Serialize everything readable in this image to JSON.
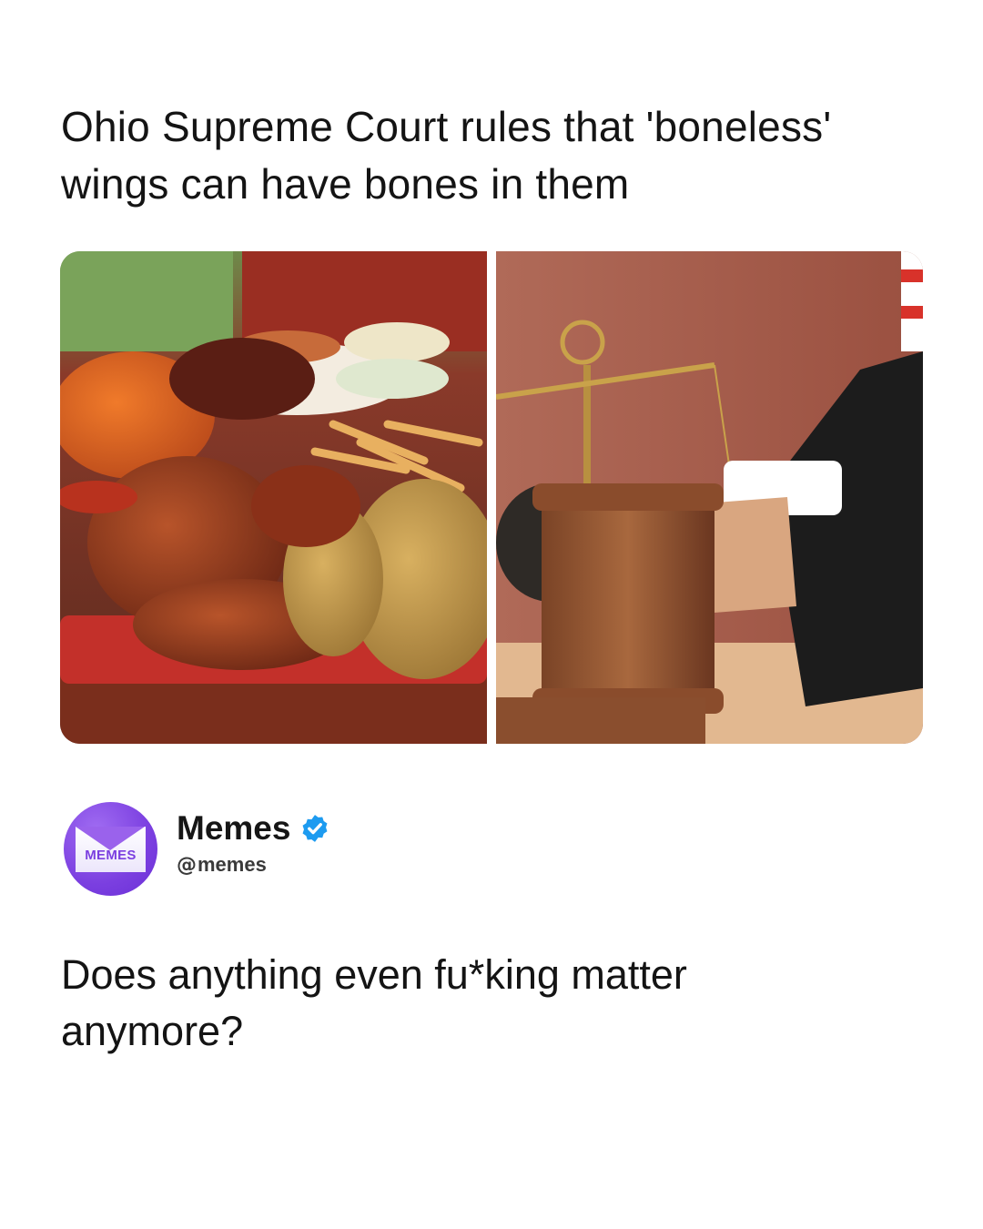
{
  "post": {
    "headline": "Ohio Supreme Court rules that 'boneless' wings can have bones in them",
    "caption": "Does anything even fu*king matter anymore?"
  },
  "media": {
    "left_image": "chicken-wings-platter-photo",
    "right_image": "judge-gavel-scales-photo"
  },
  "author": {
    "name": "Memes",
    "handle": "memes",
    "handle_icon": "threads-icon",
    "avatar_text": "MEMES",
    "verified": true
  },
  "colors": {
    "avatar": "#7b3fe0",
    "verified_badge": "#1d9bf0",
    "text": "#141414"
  }
}
